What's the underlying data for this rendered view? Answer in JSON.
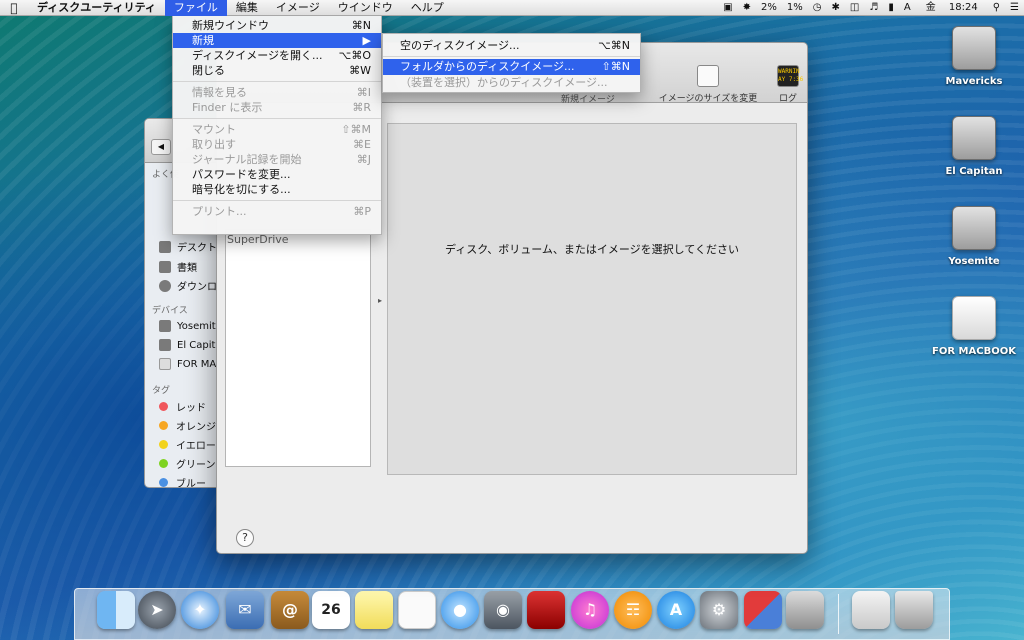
{
  "menubar": {
    "app_name": "ディスクユーティリティ",
    "items": [
      "ファイル",
      "編集",
      "イメージ",
      "ウインドウ",
      "ヘルプ"
    ],
    "status": {
      "battery_pct": "2%",
      "cpu_pct": "1%",
      "input_method": "A",
      "day": "金",
      "time": "18:24"
    }
  },
  "file_menu": {
    "items": [
      {
        "label": "新規ウインドウ",
        "shortcut": "⌘N"
      },
      {
        "label": "新規",
        "shortcut": "▶"
      },
      {
        "label": "ディスクイメージを開く...",
        "shortcut": "⌥⌘O"
      },
      {
        "label": "閉じる",
        "shortcut": "⌘W"
      },
      {
        "label": "情報を見る",
        "shortcut": "⌘I"
      },
      {
        "label": "Finder に表示",
        "shortcut": "⌘R"
      },
      {
        "label": "マウント",
        "shortcut": "⇧⌘M"
      },
      {
        "label": "取り出す",
        "shortcut": "⌘E"
      },
      {
        "label": "ジャーナル記録を開始",
        "shortcut": "⌘J"
      },
      {
        "label": "パスワードを変更...",
        "shortcut": ""
      },
      {
        "label": "暗号化を切にする...",
        "shortcut": ""
      },
      {
        "label": "プリント...",
        "shortcut": "⌘P"
      }
    ]
  },
  "new_submenu": {
    "items": [
      {
        "label": "空のディスクイメージ...",
        "shortcut": "⌥⌘N"
      },
      {
        "label": "フォルダからのディスクイメージ...",
        "shortcut": "⇧⌘N"
      },
      {
        "label": "（装置を選択）からのディスクイメージ...",
        "shortcut": ""
      }
    ]
  },
  "disk_utility": {
    "toolbar": {
      "partial_new_image": "新規イメージ",
      "resize_label": "イメージのサイズを変更",
      "log_label": "ログ",
      "log_icon_text": "WARNIN\nAY 7:36"
    },
    "sidebar_item": "SuperDrive",
    "prompt": "ディスク、ボリューム、またはイメージを選択してください",
    "help": "?"
  },
  "finder": {
    "favorites_partial": "よく使",
    "favorites": [
      "デスクト",
      "書類",
      "ダウンロ"
    ],
    "devices_header": "デバイス",
    "devices": [
      "Yosemit",
      "El Capit",
      "FOR MA"
    ],
    "tags_header": "タグ",
    "tags": [
      {
        "label": "レッド",
        "color": "#f0565c"
      },
      {
        "label": "オレンジ",
        "color": "#f6a623"
      },
      {
        "label": "イエロー",
        "color": "#f2d31b"
      },
      {
        "label": "グリーン",
        "color": "#7ed321"
      },
      {
        "label": "ブルー",
        "color": "#4a90e2"
      }
    ]
  },
  "desktop_icons": [
    "Mavericks",
    "El Capitan",
    "Yosemite",
    "FOR MACBOOK"
  ],
  "dock": {
    "calendar_day": "26",
    "apps": [
      "finder-icon",
      "launchpad-icon",
      "safari-icon",
      "mail-icon",
      "contacts-icon",
      "calendar-icon",
      "notes-icon",
      "reminders-icon",
      "messages-icon",
      "facetime-icon",
      "photo-booth-icon",
      "itunes-icon",
      "ibooks-icon",
      "app-store-icon",
      "system-preferences-icon",
      "vmware-icon",
      "disk-utility-icon",
      "downloads-icon",
      "trash-icon"
    ]
  },
  "colors": {
    "menu_highlight": "#2f62ec",
    "window_bg": "#ececec"
  }
}
